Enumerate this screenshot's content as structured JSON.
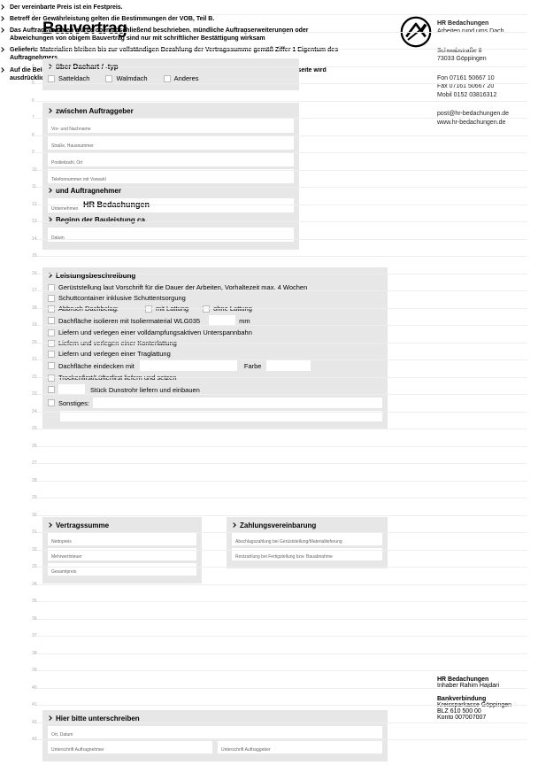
{
  "title": "Bauvertrag",
  "company": {
    "name": "HR Bedachungen",
    "tagline": "Arbeiten rund ums Dach",
    "street": "Schwabstraße 8",
    "city": "73033 Göppingen",
    "fon": "Fon    07161 50667 10",
    "fax": "Fax    07161 50667 20",
    "mobil": "Mobil  0152 03816312",
    "email": "post@hr-bedachungen.de",
    "web": "www.hr-bedachungen.de"
  },
  "sec1": {
    "header": "über Dachart / -typ",
    "opt1": "Satteldach",
    "opt2": "Walmdach",
    "opt3": "Anderes"
  },
  "sec2": {
    "header1": "zwischen Auftraggeber",
    "f1": "Vor- und Nachname",
    "f2": "Straße, Hausnummer",
    "f3": "Postleitzahl, Ort",
    "f4": "Telefonnummer mit Vorwahl",
    "header2": "und Auftragnehmer",
    "contractor_value": "HR Bedachungen",
    "contractor_lbl": "Unternehmen",
    "header3": "Beginn der Bauleistung ca.",
    "f5": "Datum"
  },
  "sec3": {
    "header": "Leistungsbeschreibung",
    "l1": "Gerüststellung laut Vorschrift für die Dauer der Arbeiten, Vorhaltezeit max. 4 Wochen",
    "l2": "Schuttcontainer inklusive Schuttentsorgung",
    "l3a": "Abbruch Dachbelag:",
    "l3b": "mit Lattung",
    "l3c": "ohne Lattung",
    "l4a": "Dachfläche isolieren mit Isoliermaterial WLG035",
    "l4b": "mm",
    "l5": "Liefern und verlegen einer volldampfungsaktiven Unterspannbahn",
    "l6": "Liefern und verlegen einer Konterlattung",
    "l7": "Liefern und verlegen einer Traglattung",
    "l8a": "Dachfläche eindecken mit",
    "l8b": "Farbe",
    "l9": "Trockenfirst/Lüfterfirst liefern und setzen",
    "l10": "Stück Dunstrohr liefern und einbauen",
    "l11": "Sonstiges:"
  },
  "secV": {
    "header": "Vertragssumme",
    "f1": "Nettopreis",
    "f2": "Mehrwertsteuer",
    "f3": "Gesamtpreis"
  },
  "secZ": {
    "header": "Zahlungsvereinbarung",
    "f1": "Abschlagszahlung bei Gerüststellung/Materiallieferung",
    "f2": "Restzahlung bei Fertigstellung bzw. Bauabnahme"
  },
  "statements": {
    "s1": "Der vereinbarte Preis ist ein Festpreis.",
    "s2": "Betreff der Gewährleistung gelten die Bestimmungen der VOB, Teil B.",
    "s3": "Das Auftragsvolumen wurde oben abschließend beschrieben, mündliche Auftragserweiterungen oder Abweichungen von obigem Bauvertrag sind nur mit schriftlicher Bestättigung wirksam",
    "s4": "Gelieferte Materialien bleiben bis zur vollständigen Bezahlung der Vertragssumme gemäß Ziffer 1 Eigentum des Auftragnehmers.",
    "s5": "Auf die Belehrung betreffend der Energieeinsparverordnung und des Widerrufrechts auf der Rückseite wird ausdrücklich hingewiesen."
  },
  "secSign": {
    "header": "Hier bitte unterschreiben",
    "f1": "Ort, Datum",
    "f2a": "Unterschrift Auftragnehmer",
    "f2b": "Unterschrift Auftraggeber"
  },
  "bank": {
    "name": "HR Bedachungen",
    "owner": "Inhaber Rahim Hajdari",
    "hdr": "Bankverbindung",
    "bank": "Kreissparkasse Göppingen",
    "blz": "BLZ 610 500 00",
    "konto": "Konto  007007007"
  }
}
